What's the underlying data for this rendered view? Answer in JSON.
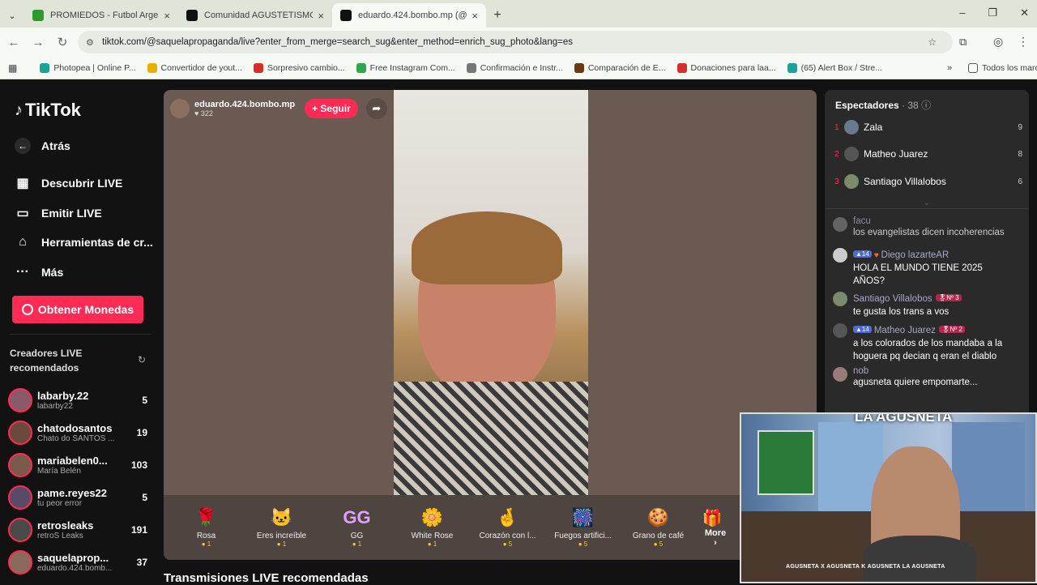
{
  "browser": {
    "tabs": [
      {
        "title": "PROMIEDOS - Futbol Argentino",
        "color": "#2e9a2e"
      },
      {
        "title": "Comunidad AGUSTETISMO (SU",
        "color": "#111111"
      },
      {
        "title": "eduardo.424.bombo.mp (@",
        "color": "#111111"
      }
    ],
    "url": "tiktok.com/@saquelapropaganda/live?enter_from_merge=search_sug&enter_method=enrich_sug_photo&lang=es",
    "bookmarks": [
      {
        "label": "Photopea | Online P...",
        "color": "#18a497"
      },
      {
        "label": "Convertidor de yout...",
        "color": "#e8b000"
      },
      {
        "label": "Sorpresivo cambio...",
        "color": "#d92b2b"
      },
      {
        "label": "Free Instagram Com...",
        "color": "#2ea84a"
      },
      {
        "label": "Confirmación e Instr...",
        "color": "#777777"
      },
      {
        "label": "Comparación de E...",
        "color": "#6a3a0e"
      },
      {
        "label": "Donaciones para laa...",
        "color": "#d62f2f"
      },
      {
        "label": "(65) Alert Box / Stre...",
        "color": "#1aa39a"
      }
    ],
    "all_bookmarks": "Todos los marcadores"
  },
  "sidebar": {
    "logo": "TikTok",
    "items": [
      {
        "label": "Atrás",
        "icon": "←"
      },
      {
        "label": "Descubrir LIVE",
        "icon": "▦"
      },
      {
        "label": "Emitir LIVE",
        "icon": "▭"
      },
      {
        "label": "Herramientas de cr...",
        "icon": "⌂"
      },
      {
        "label": "Más",
        "icon": "···"
      }
    ],
    "coins_button": "Obtener Monedas",
    "creators_title": "Creadores LIVE recomendados",
    "creators": [
      {
        "name": "labarby.22",
        "sub": "labarby22",
        "count": "5"
      },
      {
        "name": "chatodosantos",
        "sub": "Chato do SANTOS ...",
        "count": "19"
      },
      {
        "name": "mariabelen0...",
        "sub": "María Belén",
        "count": "103"
      },
      {
        "name": "pame.reyes22",
        "sub": "tu peor error",
        "count": "5"
      },
      {
        "name": "retrosleaks",
        "sub": "retroS Leaks",
        "count": "191"
      },
      {
        "name": "saquelaprop...",
        "sub": "eduardo.424.bomb...",
        "count": "37"
      }
    ]
  },
  "live": {
    "host": "eduardo.424.bombo.mp",
    "likes": "322",
    "follow": "+ Seguir",
    "gifts": [
      {
        "name": "Rosa",
        "price": "1",
        "icon": "🌹"
      },
      {
        "name": "Eres increíble",
        "price": "1",
        "icon": "🐱"
      },
      {
        "name": "GG",
        "price": "1",
        "icon": "GG"
      },
      {
        "name": "White Rose",
        "price": "1",
        "icon": "🌼"
      },
      {
        "name": "Corazón con l...",
        "price": "5",
        "icon": "🤞"
      },
      {
        "name": "Fuegos artifici...",
        "price": "5",
        "icon": "🎆"
      },
      {
        "name": "Grano de café",
        "price": "5",
        "icon": "🍪"
      }
    ],
    "more": "More ›",
    "recommended": "Transmisiones LIVE recomendadas"
  },
  "chat": {
    "viewers_title": "Espectadores",
    "viewers_count": "· 38",
    "top": [
      {
        "rank": "1",
        "name": "Zala",
        "score": "9"
      },
      {
        "rank": "2",
        "name": "Matheo Juarez",
        "score": "8"
      },
      {
        "rank": "3",
        "name": "Santiago Villalobos",
        "score": "6"
      }
    ],
    "messages": [
      {
        "user": "facu",
        "text": "los evangelistas dicen incoherencias",
        "badge1": "",
        "badge2": ""
      },
      {
        "user": "Diego lazarteAR",
        "text": "HOLA EL MUNDO TIENE 2025 AÑOS?",
        "badge1": "14",
        "badge2": ""
      },
      {
        "user": "Santiago Villalobos",
        "text": "te gusta los trans a vos",
        "badge1": "",
        "badge2": "Nº 3"
      },
      {
        "user": "Matheo Juarez",
        "text": "a los colorados de los mandaba a la hoguera pq decian q eran el diablo",
        "badge1": "14",
        "badge2": "Nº 2"
      },
      {
        "user": "nob",
        "text": "agusneta quiere empomarte...",
        "badge1": "",
        "badge2": ""
      }
    ]
  },
  "webcam": {
    "overlay": "LA AGUSNETA",
    "socials": "AGUSNETA  X AGUSNETA  K AGUSNETA  LA AGUSNETA"
  }
}
